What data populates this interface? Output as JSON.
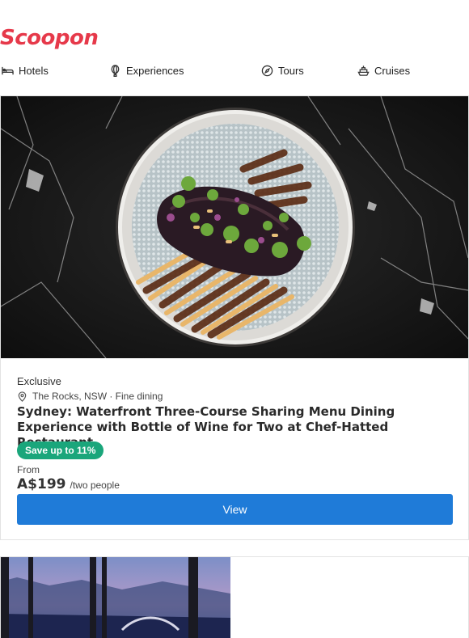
{
  "brand": {
    "logo_text": "Scoopon",
    "color": "#e6394a"
  },
  "nav": {
    "items": [
      {
        "label": "Hotels",
        "icon": "bed-icon"
      },
      {
        "label": "Experiences",
        "icon": "balloon-icon"
      },
      {
        "label": "Tours",
        "icon": "compass-icon"
      },
      {
        "label": "Cruises",
        "icon": "ship-icon"
      }
    ]
  },
  "deal": {
    "tag": "Exclusive",
    "location": "The Rocks, NSW · Fine dining",
    "title": "Sydney: Waterfront Three-Course Sharing Menu Dining Experience with Bottle of Wine for Two at Chef-Hatted Restaurant",
    "badge": "Save up to 11%",
    "from_label": "From",
    "price": "A$199",
    "per": "/two people",
    "button_label": "View",
    "image_icon": "plated-eggplant-dish-image"
  },
  "colors": {
    "accent": "#1f7bd8",
    "badge": "#1aa67b"
  }
}
